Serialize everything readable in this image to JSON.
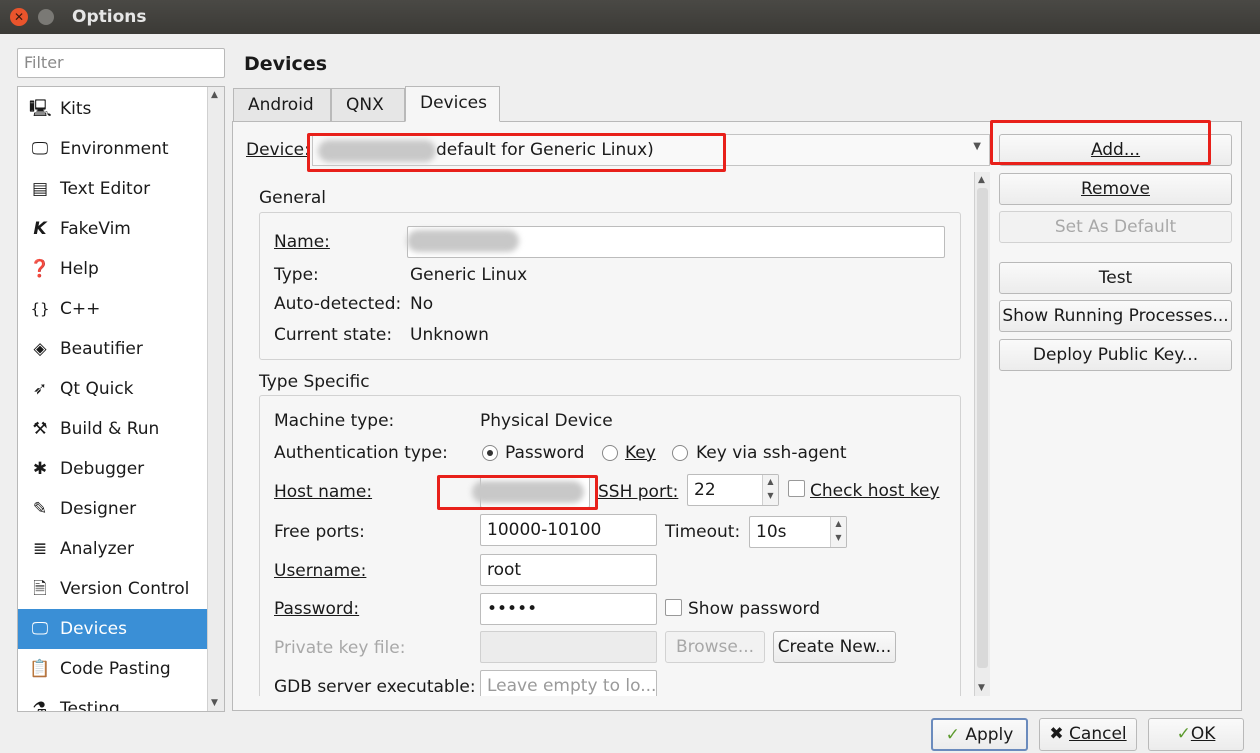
{
  "window": {
    "title": "Options"
  },
  "filter": {
    "placeholder": "Filter"
  },
  "sidebar": {
    "items": [
      {
        "label": "Kits",
        "icon": "kits-icon",
        "glyph": "🖳"
      },
      {
        "label": "Environment",
        "icon": "monitor-icon",
        "glyph": "🖵"
      },
      {
        "label": "Text Editor",
        "icon": "text-editor-icon",
        "glyph": "▤"
      },
      {
        "label": "FakeVim",
        "icon": "fakevim-icon",
        "glyph": "K"
      },
      {
        "label": "Help",
        "icon": "help-icon",
        "glyph": "❓"
      },
      {
        "label": "C++",
        "icon": "braces-icon",
        "glyph": "{}"
      },
      {
        "label": "Beautifier",
        "icon": "diamond-icon",
        "glyph": "◈"
      },
      {
        "label": "Qt Quick",
        "icon": "qtquick-icon",
        "glyph": "➶"
      },
      {
        "label": "Build & Run",
        "icon": "hammer-icon",
        "glyph": "⚒"
      },
      {
        "label": "Debugger",
        "icon": "bug-icon",
        "glyph": "✱"
      },
      {
        "label": "Designer",
        "icon": "pencil-icon",
        "glyph": "✎"
      },
      {
        "label": "Analyzer",
        "icon": "analyzer-icon",
        "glyph": "≣"
      },
      {
        "label": "Version Control",
        "icon": "version-control-icon",
        "glyph": "🗎"
      },
      {
        "label": "Devices",
        "icon": "devices-icon",
        "glyph": "🖵",
        "active": true
      },
      {
        "label": "Code Pasting",
        "icon": "clipboard-icon",
        "glyph": "📋"
      },
      {
        "label": "Testing",
        "icon": "testing-icon",
        "glyph": "⚗"
      }
    ]
  },
  "page": {
    "title": "Devices"
  },
  "tabs": [
    {
      "label": "Android"
    },
    {
      "label": "QNX"
    },
    {
      "label": "Devices",
      "active": true
    }
  ],
  "device_selector": {
    "label": "Device:",
    "value": "default for Generic Linux)"
  },
  "actions": {
    "add": "Add...",
    "remove": "Remove",
    "set_default": "Set As Default",
    "test": "Test",
    "show_processes": "Show Running Processes...",
    "deploy_key": "Deploy Public Key..."
  },
  "general": {
    "title": "General",
    "name_label": "Name:",
    "name_value": "",
    "type_label": "Type:",
    "type_value": "Generic Linux",
    "autodetected_label": "Auto-detected:",
    "autodetected_value": "No",
    "state_label": "Current state:",
    "state_value": "Unknown"
  },
  "type_specific": {
    "title": "Type Specific",
    "machine_type_label": "Machine type:",
    "machine_type_value": "Physical Device",
    "auth_label": "Authentication type:",
    "auth_options": [
      "Password",
      "Key",
      "Key via ssh-agent"
    ],
    "auth_selected": "Password",
    "host_label": "Host name:",
    "host_value": "",
    "ssh_port_label": "SSH port:",
    "ssh_port_value": "22",
    "check_host_key_label": "Check host key",
    "free_ports_label": "Free ports:",
    "free_ports_value": "10000-10100",
    "timeout_label": "Timeout:",
    "timeout_value": "10s",
    "username_label": "Username:",
    "username_value": "root",
    "password_label": "Password:",
    "password_value": "•••••",
    "show_password_label": "Show password",
    "private_key_label": "Private key file:",
    "browse_label": "Browse...",
    "create_new_label": "Create New...",
    "gdb_label": "GDB server executable:",
    "gdb_placeholder": "Leave empty to lo..."
  },
  "footer": {
    "apply": "Apply",
    "cancel": "Cancel",
    "ok": "OK"
  },
  "colors": {
    "accent": "#3a8fd6",
    "highlight_red": "#e8201a",
    "check_green": "#5c9a2e"
  }
}
